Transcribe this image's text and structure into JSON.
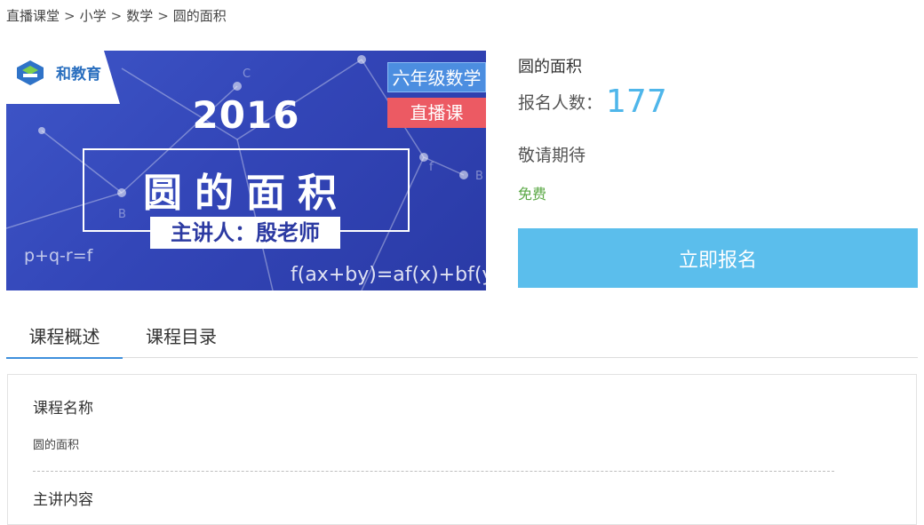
{
  "breadcrumb": {
    "items": [
      "直播课堂",
      "小学",
      "数学",
      "圆的面积"
    ],
    "separator": ">"
  },
  "banner": {
    "logo_text": "和教育",
    "grade_tag": "六年级数学",
    "live_tag": "直播课",
    "year": "2016",
    "title": "圆的面积",
    "speaker": "主讲人：殷老师",
    "formula_right": "f(ax+by)=af(x)+bf(y)",
    "formula_left": "p+q-r=f",
    "colors": {
      "background": "#3346b8",
      "grade_tag": "#4c8ee0",
      "live_tag": "#ec5a63"
    }
  },
  "course": {
    "title": "圆的面积",
    "enroll_label": "报名人数：",
    "enroll_count": "177",
    "status": "敬请期待",
    "price": "免费",
    "enroll_button": "立即报名",
    "colors": {
      "accent": "#5bbeec",
      "count": "#4fb6ea",
      "price": "#5aa845"
    }
  },
  "tabs": [
    {
      "label": "课程概述",
      "active": true
    },
    {
      "label": "课程目录",
      "active": false
    }
  ],
  "details": {
    "course_name_heading": "课程名称",
    "course_name_value": "圆的面积",
    "lecture_content_heading": "主讲内容"
  }
}
